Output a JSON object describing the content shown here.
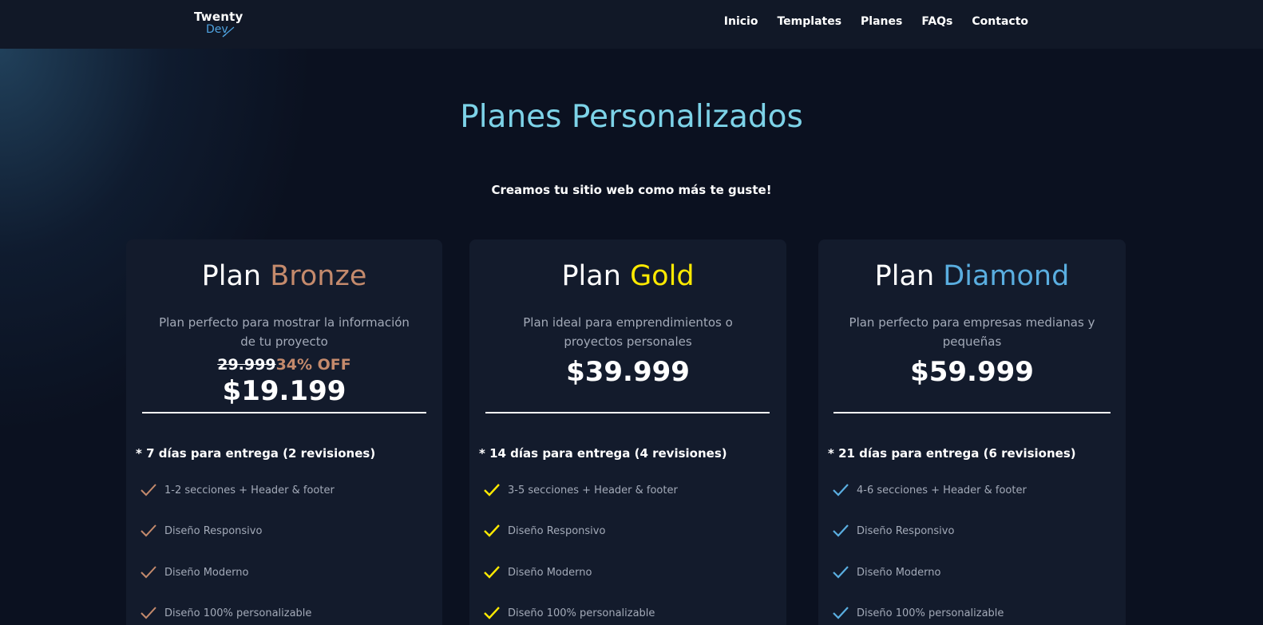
{
  "brand": {
    "line1": "Twenty",
    "line2": "Dev"
  },
  "nav": [
    "Inicio",
    "Templates",
    "Planes",
    "FAQs",
    "Contacto"
  ],
  "hero": {
    "title": "Planes Personalizados",
    "subtitle": "Creamos tu sitio web como más te guste!"
  },
  "colors": {
    "bronze": "#c48a6c",
    "gold": "#ffea00",
    "diamond": "#5aaee0",
    "title": "#7dd3e8"
  },
  "plans": [
    {
      "prefix": "Plan",
      "name": "Bronze",
      "description": "Plan perfecto para mostrar la información de tu proyecto",
      "old_price": "29.999",
      "discount": "34% OFF",
      "price": "$19.199",
      "delivery": "* 7 días para entrega (2 revisiones)",
      "features": [
        "1-2 secciones + Header & footer",
        "Diseño Responsivo",
        "Diseño Moderno",
        "Diseño 100% personalizable"
      ]
    },
    {
      "prefix": "Plan",
      "name": "Gold",
      "description": "Plan ideal para emprendimientos o proyectos personales",
      "price": "$39.999",
      "delivery": "* 14 días para entrega (4 revisiones)",
      "features": [
        "3-5 secciones + Header & footer",
        "Diseño Responsivo",
        "Diseño Moderno",
        "Diseño 100% personalizable"
      ]
    },
    {
      "prefix": "Plan",
      "name": "Diamond",
      "description": "Plan perfecto para empresas medianas y pequeñas",
      "price": "$59.999",
      "delivery": "* 21 días para entrega (6 revisiones)",
      "features": [
        "4-6 secciones + Header & footer",
        "Diseño Responsivo",
        "Diseño Moderno",
        "Diseño 100% personalizable"
      ]
    }
  ]
}
